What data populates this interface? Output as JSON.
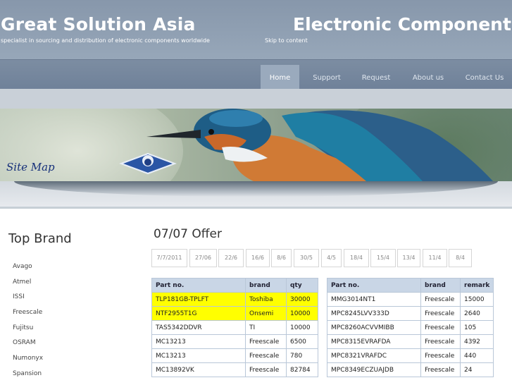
{
  "header": {
    "title": "Great Solution Asia",
    "tagline": "specialist in sourcing and distribution of electronic components worldwide",
    "skip_link": "Skip to content",
    "right_title": "Electronic Components"
  },
  "nav": {
    "items": [
      {
        "label": "Home",
        "active": true
      },
      {
        "label": "Support",
        "active": false
      },
      {
        "label": "Request",
        "active": false
      },
      {
        "label": "About us",
        "active": false
      },
      {
        "label": "Contact Us",
        "active": false
      }
    ]
  },
  "banner": {
    "sitemap_label": "Site Map",
    "image": "kingfisher-bird"
  },
  "sidebar": {
    "title": "Top Brand",
    "brands": [
      "Avago",
      "Atmel",
      "ISSI",
      "Freescale",
      "Fujitsu",
      "OSRAM",
      "Numonyx",
      "Spansion"
    ]
  },
  "offer": {
    "title": "07/07 Offer",
    "dates": [
      "7/7/2011",
      "27/06",
      "22/6",
      "16/6",
      "8/6",
      "30/5",
      "4/5",
      "18/4",
      "15/4",
      "13/4",
      "11/4",
      "8/4"
    ]
  },
  "table_left": {
    "headers": [
      "Part no.",
      "brand",
      "qty"
    ],
    "rows": [
      {
        "cells": [
          "TLP181GB-TPLFT",
          "Toshiba",
          "30000"
        ],
        "highlight": true
      },
      {
        "cells": [
          "NTF2955T1G",
          "Onsemi",
          "10000"
        ],
        "highlight": true
      },
      {
        "cells": [
          "TAS5342DDVR",
          "TI",
          "10000"
        ],
        "highlight": false
      },
      {
        "cells": [
          "MC13213",
          "Freescale",
          "6500"
        ],
        "highlight": false
      },
      {
        "cells": [
          "MC13213",
          "Freescale",
          "780"
        ],
        "highlight": false
      },
      {
        "cells": [
          "MC13892VK",
          "Freescale",
          "82784"
        ],
        "highlight": false
      }
    ]
  },
  "table_right": {
    "headers": [
      "Part no.",
      "brand",
      "remark"
    ],
    "rows": [
      {
        "cells": [
          "MMG3014NT1",
          "Freescale",
          "15000"
        ]
      },
      {
        "cells": [
          "MPC8245LVV333D",
          "Freescale",
          "2640"
        ]
      },
      {
        "cells": [
          "MPC8260ACVVMIBB",
          "Freescale",
          "105"
        ]
      },
      {
        "cells": [
          "MPC8315EVRAFDA",
          "Freescale",
          "4392"
        ]
      },
      {
        "cells": [
          "MPC8321VRAFDC",
          "Freescale",
          "440"
        ]
      },
      {
        "cells": [
          "MPC8349ECZUAJDB",
          "Freescale",
          "24"
        ]
      }
    ]
  },
  "colors": {
    "header_bg": "#8f9fb3",
    "nav_bg": "#7a8ba0",
    "nav_active": "#9aaabd",
    "table_header": "#c9d6e6",
    "highlight": "#ffff00"
  }
}
